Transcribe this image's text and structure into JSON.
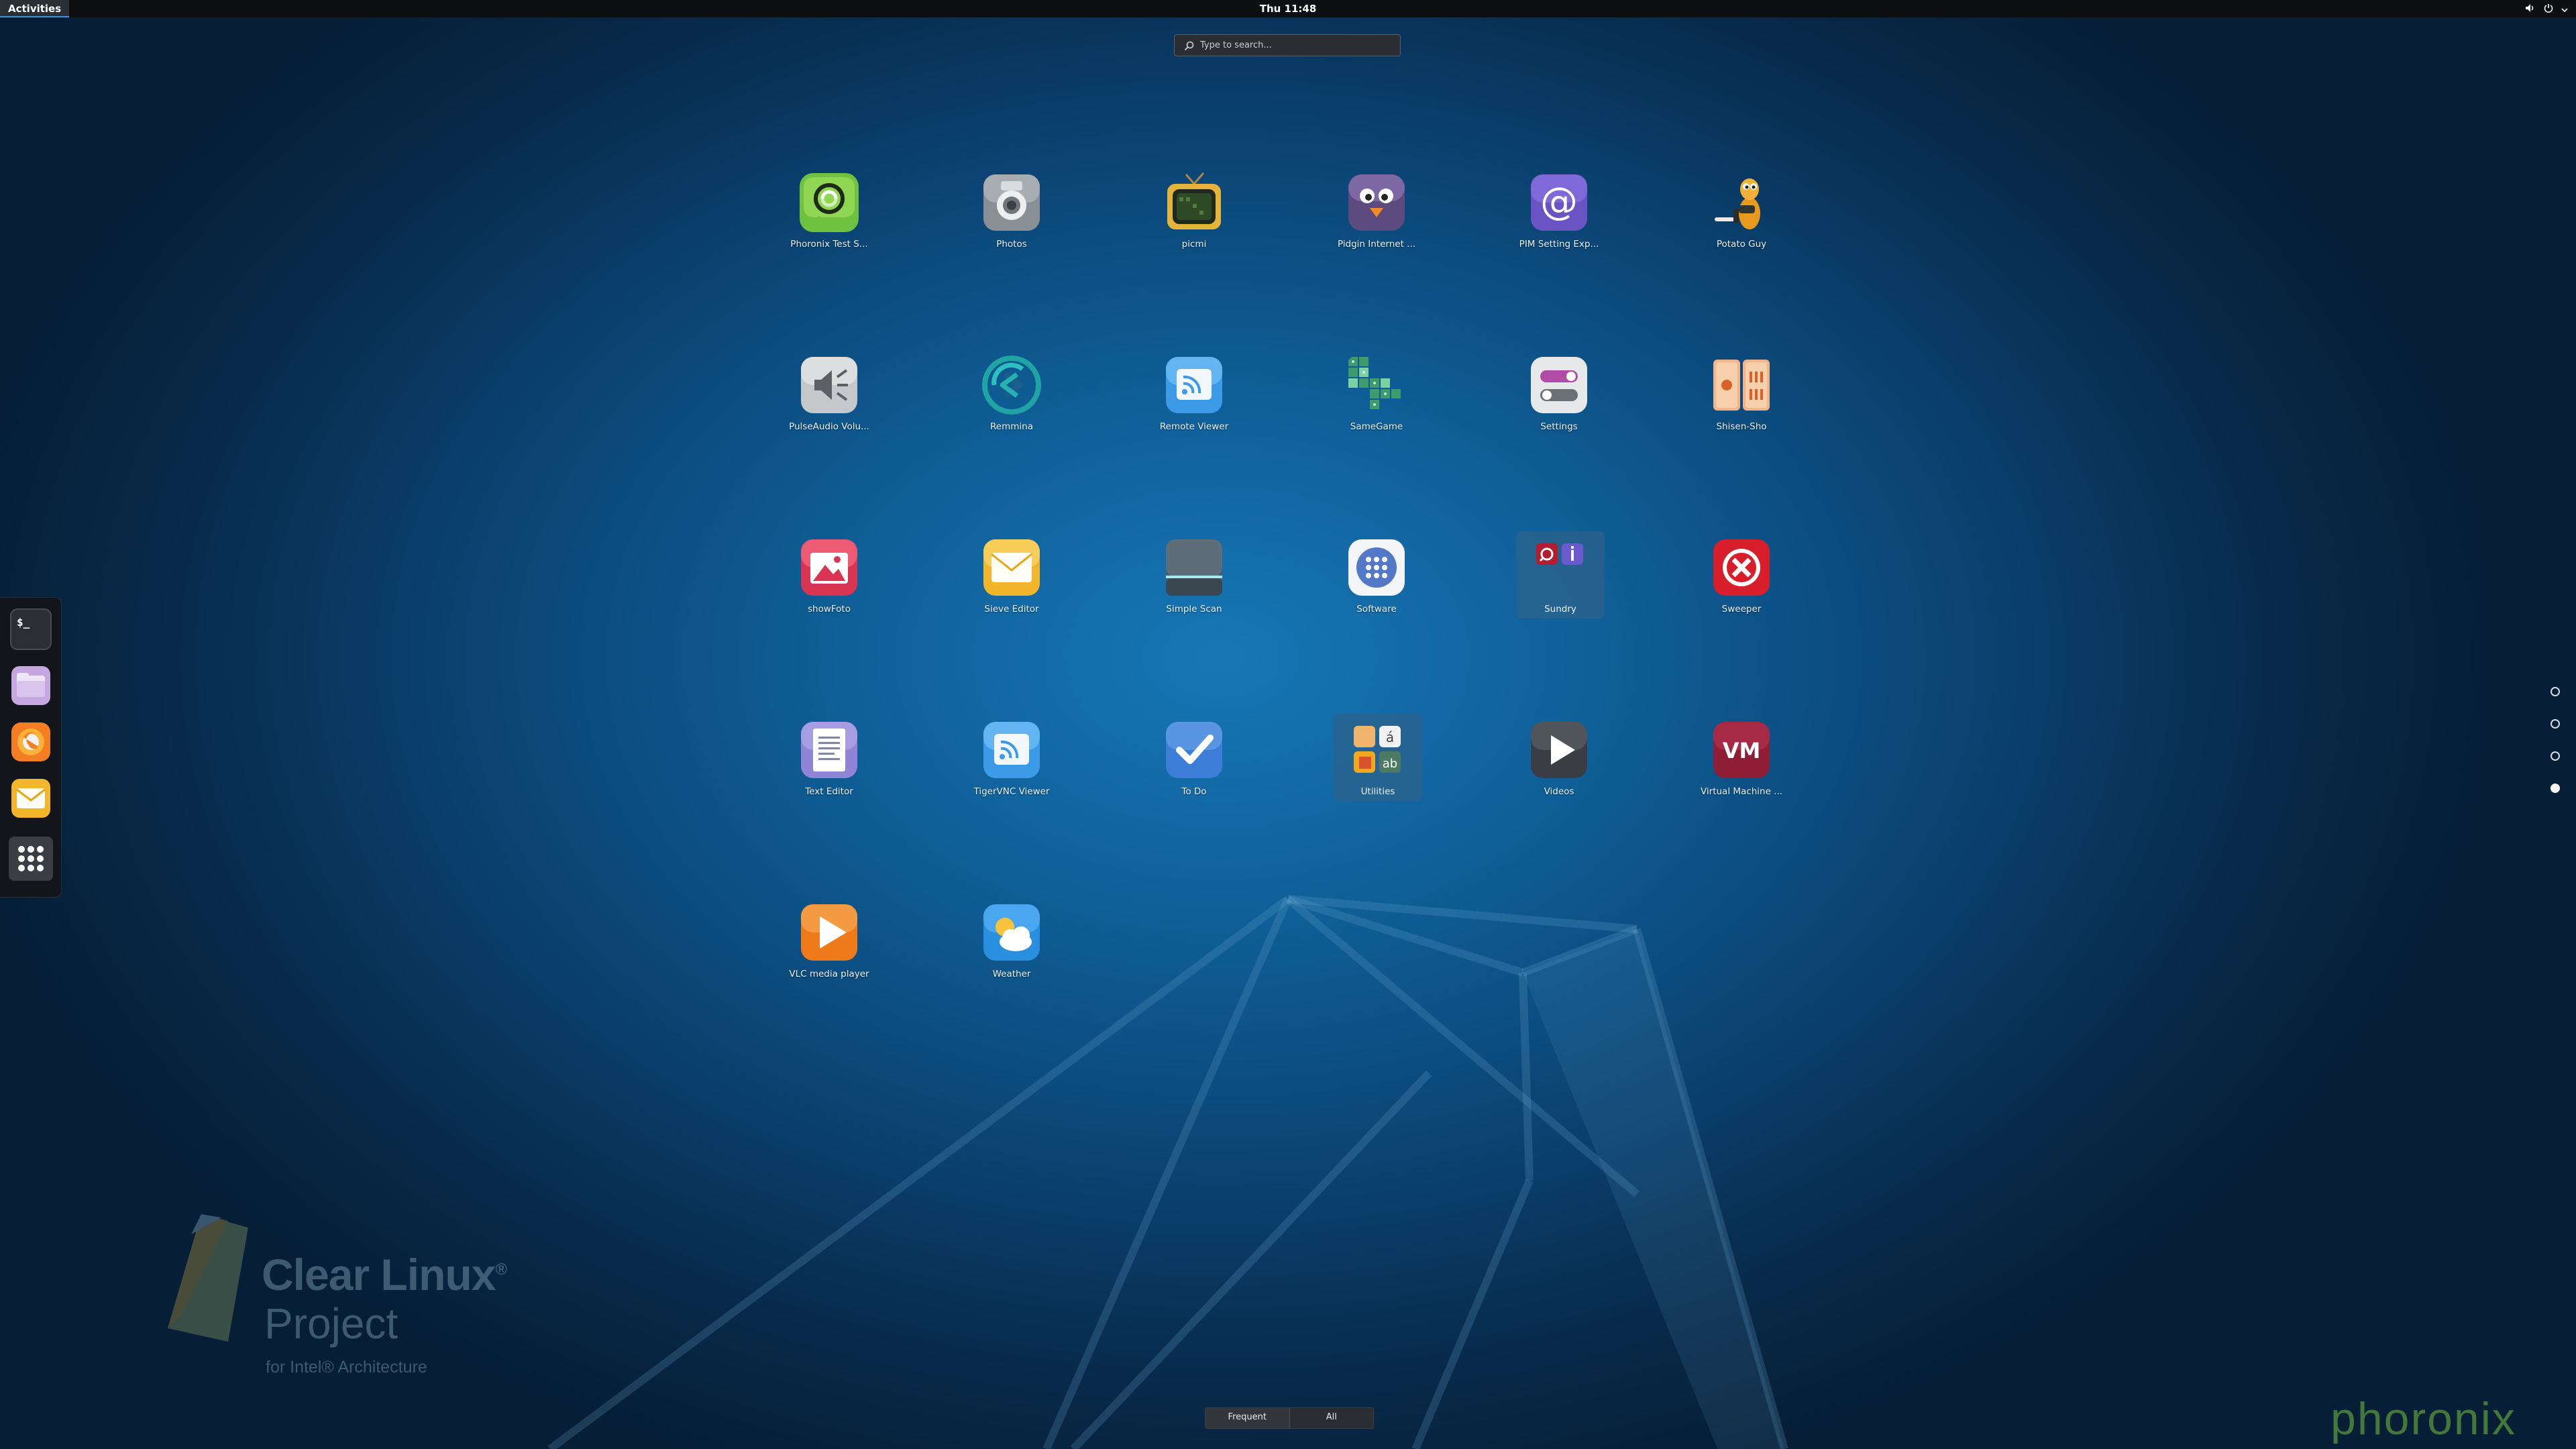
{
  "topbar": {
    "activities": "Activities",
    "clock": "Thu 11:48"
  },
  "search": {
    "placeholder": "Type to search..."
  },
  "apps": [
    {
      "label": "Phoronix Test S...",
      "icon": "phoronix-test-suite-icon"
    },
    {
      "label": "Photos",
      "icon": "camera-icon"
    },
    {
      "label": "picmi",
      "icon": "tv-icon"
    },
    {
      "label": "Pidgin Internet ...",
      "icon": "pidgin-bird-icon"
    },
    {
      "label": "PIM Setting Exp...",
      "icon": "at-sign-icon"
    },
    {
      "label": "Potato Guy",
      "icon": "potato-guy-icon"
    },
    {
      "label": "PulseAudio Volu...",
      "icon": "speaker-icon"
    },
    {
      "label": "Remmina",
      "icon": "remmina-icon"
    },
    {
      "label": "Remote Viewer",
      "icon": "remote-viewer-icon"
    },
    {
      "label": "SameGame",
      "icon": "samegame-icon"
    },
    {
      "label": "Settings",
      "icon": "toggle-switches-icon"
    },
    {
      "label": "Shisen-Sho",
      "icon": "mahjong-tiles-icon"
    },
    {
      "label": "showFoto",
      "icon": "picture-icon"
    },
    {
      "label": "Sieve Editor",
      "icon": "envelope-icon"
    },
    {
      "label": "Simple Scan",
      "icon": "scanner-icon"
    },
    {
      "label": "Software",
      "icon": "software-grid-icon"
    },
    {
      "label": "Sundry",
      "icon": "sundry-folder-icon"
    },
    {
      "label": "Sweeper",
      "icon": "sweeper-x-icon"
    },
    {
      "label": "Text Editor",
      "icon": "text-document-icon"
    },
    {
      "label": "TigerVNC Viewer",
      "icon": "vnc-viewer-icon"
    },
    {
      "label": "To Do",
      "icon": "checkmark-icon"
    },
    {
      "label": "Utilities",
      "icon": "utilities-folder-icon"
    },
    {
      "label": "Videos",
      "icon": "play-icon"
    },
    {
      "label": "Virtual Machine ...",
      "icon": "vm-icon"
    },
    {
      "label": "VLC media player",
      "icon": "vlc-play-icon"
    },
    {
      "label": "Weather",
      "icon": "weather-icon"
    }
  ],
  "dash": [
    {
      "name": "terminal-icon",
      "text": "$_"
    },
    {
      "name": "files-folder-icon"
    },
    {
      "name": "firefox-icon"
    },
    {
      "name": "mail-icon"
    },
    {
      "name": "show-applications-icon"
    }
  ],
  "pages": {
    "count": 4,
    "active_index": 3
  },
  "switcher": {
    "frequent": "Frequent",
    "all": "All"
  },
  "watermark": {
    "clear_linux": "Clear Linux",
    "registered": "®",
    "project": "Project",
    "intel": "for Intel® Architecture",
    "site": "phoronix"
  },
  "colors": {
    "accent": "#4a90d9",
    "topbar": "#0d0f11",
    "background": "#0f5f98"
  }
}
